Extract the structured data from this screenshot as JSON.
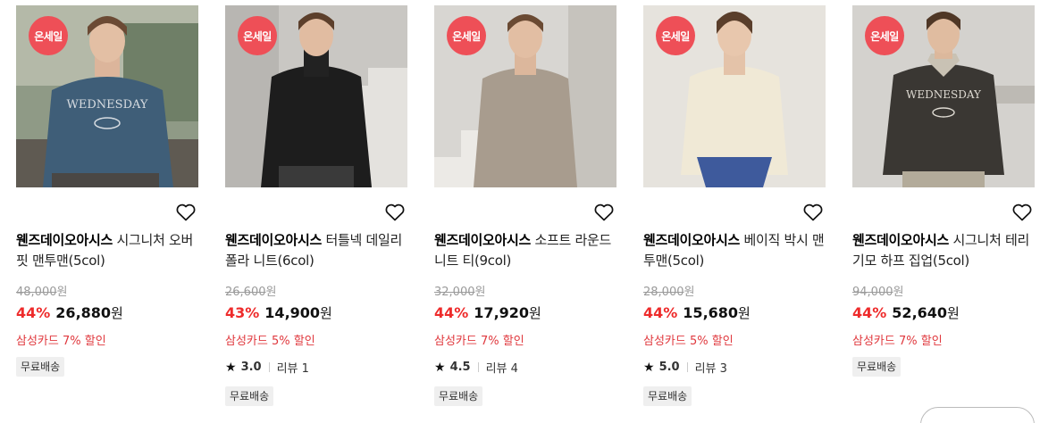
{
  "products": [
    {
      "badge": "온세일",
      "brand": "웬즈데이오아시스",
      "name": " 시그니처 오버핏 맨투맨(5col)",
      "original_price": "48,000",
      "discount": "44%",
      "sale_price": "26,880",
      "won": "원",
      "card_promo": "삼성카드 7% 할인",
      "rating": null,
      "reviews": null,
      "shipping": "무료배송"
    },
    {
      "badge": "온세일",
      "brand": "웬즈데이오아시스",
      "name": " 터틀넥 데일리 폴라 니트(6col)",
      "original_price": "26,600",
      "discount": "43%",
      "sale_price": "14,900",
      "won": "원",
      "card_promo": "삼성카드 5% 할인",
      "rating": "3.0",
      "reviews": "리뷰 1",
      "shipping": "무료배송"
    },
    {
      "badge": "온세일",
      "brand": "웬즈데이오아시스",
      "name": " 소프트 라운드 니트 티(9col)",
      "original_price": "32,000",
      "discount": "44%",
      "sale_price": "17,920",
      "won": "원",
      "card_promo": "삼성카드 7% 할인",
      "rating": "4.5",
      "reviews": "리뷰 4",
      "shipping": "무료배송"
    },
    {
      "badge": "온세일",
      "brand": "웬즈데이오아시스",
      "name": " 베이직 박시 맨투맨(5col)",
      "original_price": "28,000",
      "discount": "44%",
      "sale_price": "15,680",
      "won": "원",
      "card_promo": "삼성카드 5% 할인",
      "rating": "5.0",
      "reviews": "리뷰 3",
      "shipping": "무료배송"
    },
    {
      "badge": "온세일",
      "brand": "웬즈데이오아시스",
      "name": " 시그니처 테리 기모 하프 집업(5col)",
      "original_price": "94,000",
      "discount": "44%",
      "sale_price": "52,640",
      "won": "원",
      "card_promo": "삼성카드 7% 할인",
      "rating": null,
      "reviews": null,
      "shipping": "무료배송"
    }
  ],
  "colors": {
    "sale_badge": "#ee4f57",
    "discount": "#ee2b2b",
    "card_promo": "#e0393e",
    "original_price": "#9a9a9a"
  },
  "icons": {
    "wishlist": "heart-outline-icon",
    "rating": "star-icon"
  }
}
